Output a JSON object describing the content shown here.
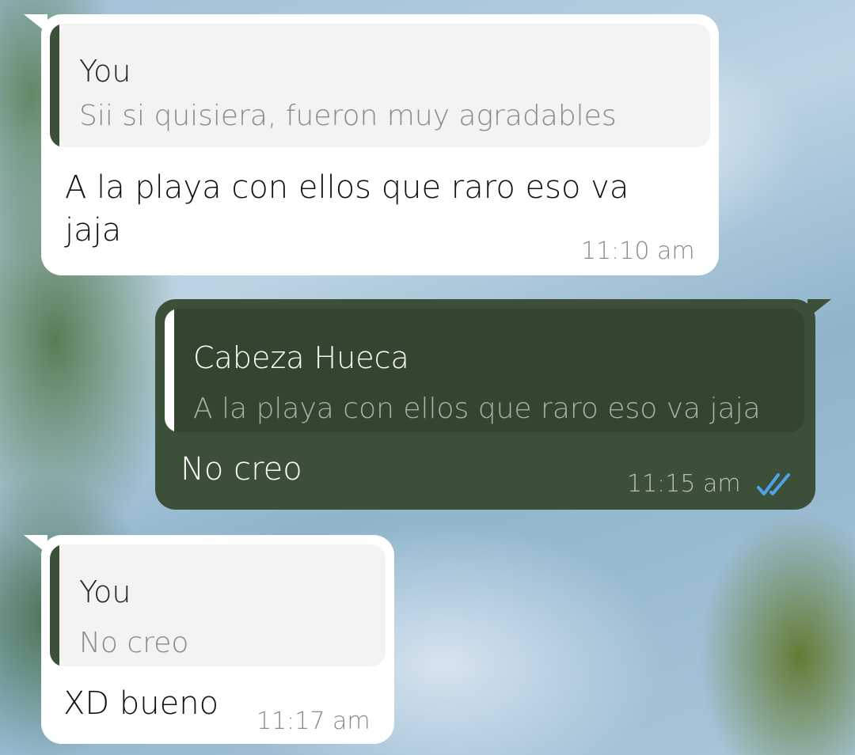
{
  "chat": {
    "messages": [
      {
        "direction": "incoming",
        "reply_to": {
          "author": "You",
          "text": "Sii si quisiera, fueron muy agradables"
        },
        "text": "A la playa con ellos que raro eso va jaja",
        "time": "11:10 am"
      },
      {
        "direction": "outgoing",
        "reply_to": {
          "author": "Cabeza Hueca",
          "text": "A la playa con ellos que raro eso va jaja"
        },
        "text": "No creo",
        "time": "11:15 am",
        "status_icon": "double-check-read-icon"
      },
      {
        "direction": "incoming",
        "reply_to": {
          "author": "You",
          "text": "No creo"
        },
        "text": "XD bueno",
        "time": "11:17 am"
      }
    ]
  },
  "colors": {
    "outgoing_bubble": "#3c4f39",
    "incoming_bubble": "#ffffff",
    "read_ticks": "#4fa3e8"
  }
}
